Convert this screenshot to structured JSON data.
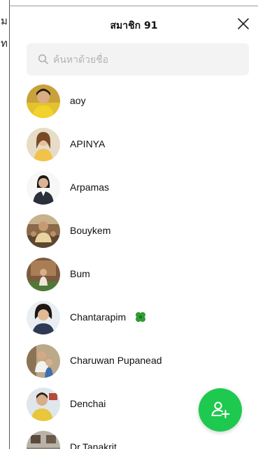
{
  "header": {
    "title": "สมาชิก 91"
  },
  "left_strip": {
    "top_fragment": "ม",
    "second_fragment": "ท"
  },
  "search": {
    "placeholder": "ค้นหาด้วยชื่อ"
  },
  "members": [
    {
      "name": "aoy"
    },
    {
      "name": "APINYA"
    },
    {
      "name": "Arpamas"
    },
    {
      "name": "Bouykem"
    },
    {
      "name": "Bum"
    },
    {
      "name": "Chantarapim"
    },
    {
      "name": "Charuwan Pupanead"
    },
    {
      "name": "Denchai"
    },
    {
      "name": "Dr.Tanakrit"
    }
  ],
  "icons": {
    "close": "close-icon",
    "search": "search-icon",
    "add_member": "add-user-icon",
    "clover": "four-leaf-clover-icon"
  },
  "colors": {
    "fab": "#1ec94f",
    "search_bg": "#f3f3f4"
  }
}
